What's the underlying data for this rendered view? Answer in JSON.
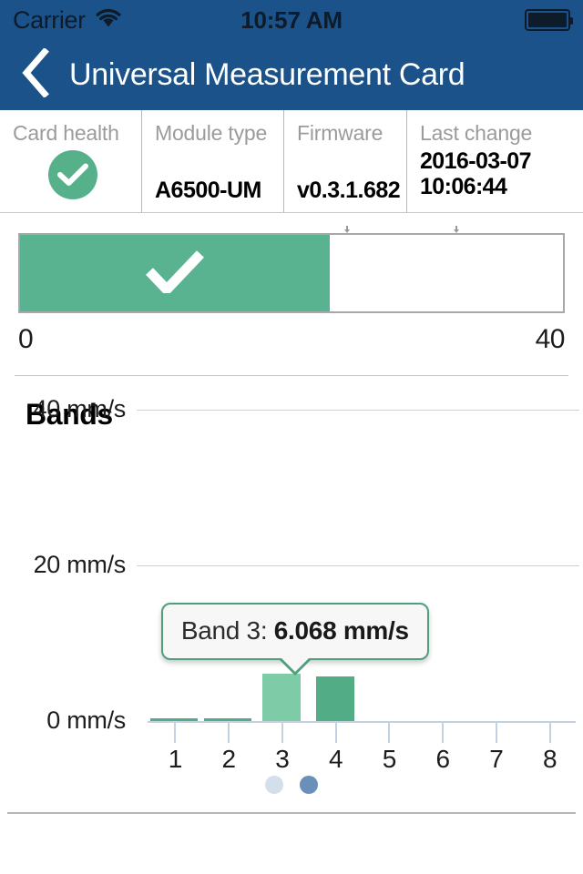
{
  "status_bar": {
    "carrier": "Carrier",
    "wifi_icon": "wifi-icon",
    "time": "10:57 AM",
    "battery_icon": "battery-full-icon"
  },
  "nav_bar": {
    "back_icon": "chevron-left-icon",
    "title": "Universal Measurement Card",
    "background_color": "#1a5289"
  },
  "info_table": {
    "cells": [
      {
        "label": "Card health",
        "value": "",
        "icon": "check-circle-icon",
        "status_color": "#56b18b"
      },
      {
        "label": "Module type",
        "value": "A6500-UM"
      },
      {
        "label": "Firmware",
        "value": "v0.3.1.682"
      },
      {
        "label": "Last change",
        "value_line1": "2016-03-07",
        "value_line2": "10:06:44"
      }
    ]
  },
  "gauge": {
    "fill_percent": 57,
    "fill_color": "#59b391",
    "check_icon": "check-icon",
    "min_label": "0",
    "max_label": "40",
    "markers": [
      {
        "position_percent": 60
      },
      {
        "position_percent": 80
      }
    ]
  },
  "bands": {
    "title": "Bands",
    "tooltip": {
      "prefix": "Band 3: ",
      "value": "6.068 mm/s",
      "border_color": "#4e9f7c"
    },
    "pagination": {
      "dots": 2,
      "active_index": 1,
      "active_color": "#6a8fb8",
      "inactive_color": "#d3dfeb"
    }
  },
  "chart_data": {
    "type": "bar",
    "title": "Bands",
    "xlabel": "",
    "ylabel": "mm/s",
    "categories": [
      "1",
      "2",
      "3",
      "4",
      "5",
      "6",
      "7",
      "8"
    ],
    "values": [
      0.35,
      0.35,
      6.068,
      5.75,
      0,
      0,
      0,
      0
    ],
    "ylim": [
      0,
      46
    ],
    "ytick_values": [
      0,
      20,
      40
    ],
    "ytick_labels": [
      "0 mm/s",
      "20 mm/s",
      "40 mm/s"
    ],
    "grid": true,
    "legend": "none",
    "highlighted_index": 2,
    "bar_color": "#52ac86",
    "highlight_color": "#7ecba8",
    "annotations": [
      {
        "label": "Band 3: 6.068 mm/s",
        "attached_to_category": "3"
      }
    ]
  }
}
